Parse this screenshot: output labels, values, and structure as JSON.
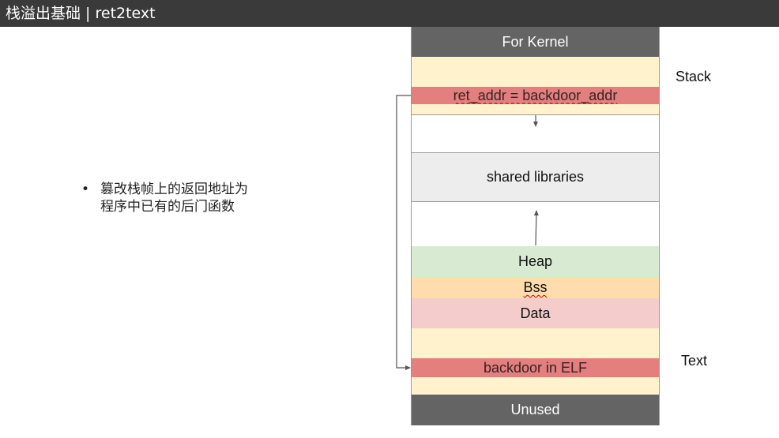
{
  "header": {
    "title": "栈溢出基础 | ret2text"
  },
  "bullet": {
    "marker": "•",
    "lines": [
      "篡改栈帧上的返回地址为",
      "程序中已有的后门函数"
    ]
  },
  "memory": {
    "segments": {
      "kernel": "For Kernel",
      "ret_addr": "ret_addr = backdoor_addr",
      "shared": "shared libraries",
      "heap": "Heap",
      "bss": "Bss",
      "data": "Data",
      "backdoor": "backdoor in ELF",
      "unused": "Unused"
    },
    "labels": {
      "stack": "Stack",
      "text": "Text"
    }
  },
  "colors": {
    "title_bar": "#3a3a3a",
    "gray": "#646464",
    "cream": "#fff2cc",
    "red": "#e37f7f",
    "light_gray": "#ededed",
    "green": "#d9ead3",
    "orange": "#ffdcae",
    "pink": "#f4cccc"
  }
}
